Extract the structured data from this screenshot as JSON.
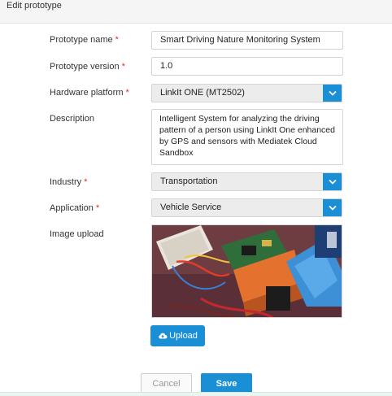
{
  "header": {
    "title": "Edit prototype"
  },
  "form": {
    "prototype_name": {
      "label": "Prototype name",
      "required": "*",
      "value": "Smart Driving Nature Monitoring System"
    },
    "prototype_version": {
      "label": "Prototype version",
      "required": "*",
      "value": "1.0"
    },
    "hardware_platform": {
      "label": "Hardware platform",
      "required": "*",
      "value": "LinkIt ONE (MT2502)"
    },
    "description": {
      "label": "Description",
      "value": "Intelligent System for analyzing the driving pattern of a person using LinkIt One enhanced by GPS and sensors with Mediatek Cloud Sandbox"
    },
    "industry": {
      "label": "Industry",
      "required": "*",
      "value": "Transportation"
    },
    "application": {
      "label": "Application",
      "required": "*",
      "value": "Vehicle Service"
    },
    "image_upload": {
      "label": "Image upload",
      "upload_label": "Upload"
    }
  },
  "actions": {
    "cancel_label": "Cancel",
    "save_label": "Save"
  },
  "icons": {
    "select_arrow": "chevron-down-icon",
    "upload": "cloud-upload-icon"
  },
  "colors": {
    "accent": "#1a8fd5",
    "required": "#e0302e"
  }
}
